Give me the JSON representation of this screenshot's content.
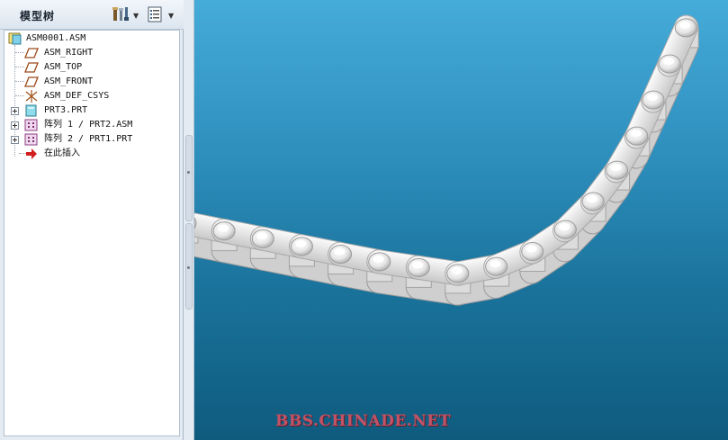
{
  "panel": {
    "title": "模型树"
  },
  "tree": {
    "items": [
      {
        "label": "ASM0001.ASM",
        "icon": "assembly-icon"
      },
      {
        "label": "ASM_RIGHT",
        "icon": "datum-plane-icon"
      },
      {
        "label": "ASM_TOP",
        "icon": "datum-plane-icon"
      },
      {
        "label": "ASM_FRONT",
        "icon": "datum-plane-icon"
      },
      {
        "label": "ASM_DEF_CSYS",
        "icon": "coordinate-system-icon"
      },
      {
        "label": "PRT3.PRT",
        "icon": "part-icon"
      },
      {
        "label": "阵列 1 / PRT2.ASM",
        "icon": "pattern-icon"
      },
      {
        "label": "阵列 2 / PRT1.PRT",
        "icon": "pattern-icon"
      },
      {
        "label": "在此插入",
        "icon": "insert-here-arrow-icon"
      }
    ]
  },
  "viewport": {
    "watermark": "BBS.CHINADE.NET"
  },
  "colors": {
    "viewport_top": "#45abd9",
    "viewport_bottom": "#0f5b7e",
    "watermark": "#c25366",
    "insert_arrow": "#d21f1f"
  }
}
